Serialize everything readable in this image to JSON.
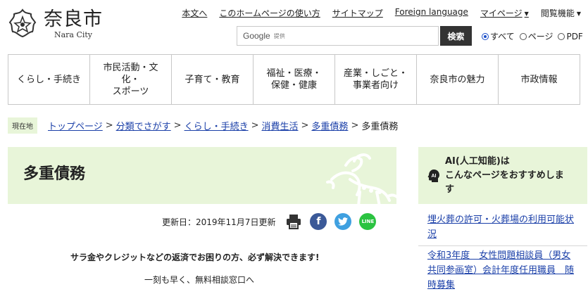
{
  "header": {
    "logo_ja": "奈良市",
    "logo_en": "Nara City",
    "util_nav": [
      {
        "label": "本文へ"
      },
      {
        "label": "このホームページの使い方"
      },
      {
        "label": "サイトマップ"
      },
      {
        "label": "Foreign language"
      },
      {
        "label": "マイページ"
      }
    ],
    "view_function": "閲覧機能",
    "search": {
      "google_label": "Google",
      "google_sub": "提供",
      "placeholder": "",
      "button": "検索"
    },
    "radios": [
      {
        "label": "すべて",
        "checked": true
      },
      {
        "label": "ページ",
        "checked": false
      },
      {
        "label": "PDF",
        "checked": false
      }
    ]
  },
  "global_nav": [
    "くらし・手続き",
    "市民活動・文\n化・\nスポーツ",
    "子育て・教育",
    "福祉・医療・\n保健・健康",
    "産業・しごと・\n事業者向け",
    "奈良市の魅力",
    "市政情報"
  ],
  "breadcrumb": {
    "label": "現在地",
    "links": [
      "トップページ",
      "分類でさがす",
      "くらし・手続き",
      "消費生活",
      "多重債務"
    ],
    "current": "多重債務",
    "separator": ">"
  },
  "page": {
    "title": "多重債務",
    "updated": "更新日：2019年11月7日更新",
    "body_1": "サラ金やクレジットなどの返済でお困りの方、必ず解決できます!",
    "body_2": "一刻も早く、無料相談窓口へ"
  },
  "ai_panel": {
    "icon_text": "AI",
    "title": "AI(人工知能)は\nこんなページをおすすめしま\nす",
    "items": [
      "埋火葬の許可・火葬場の利用可能状\n況",
      "令和3年度　女性問題相談員（男女\n共同参画室）会計年度任用職員　随\n時募集"
    ]
  },
  "colors": {
    "accent_green": "#e8f5d9",
    "link_blue": "#1a3fa8",
    "facebook": "#3b5998",
    "twitter": "#3fa0e0",
    "line": "#2bc341"
  },
  "icons": [
    "nara-emblem-icon",
    "print-icon",
    "facebook-icon",
    "twitter-icon",
    "line-icon",
    "ai-head-icon",
    "deer-illustration"
  ]
}
